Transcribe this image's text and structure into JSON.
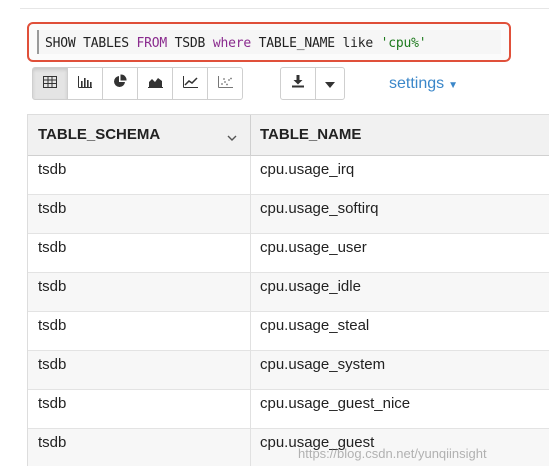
{
  "query": {
    "parts": [
      {
        "text": "SHOW TABLES ",
        "kind": "plain"
      },
      {
        "text": "FROM",
        "kind": "kw2"
      },
      {
        "text": " TSDB ",
        "kind": "plain"
      },
      {
        "text": "where",
        "kind": "kw2"
      },
      {
        "text": " TABLE_NAME like ",
        "kind": "plain"
      },
      {
        "text": "'cpu%'",
        "kind": "str"
      }
    ]
  },
  "toolbar": {
    "view_buttons": [
      {
        "name": "table-view-button",
        "icon": "table-icon",
        "active": true
      },
      {
        "name": "bar-chart-button",
        "icon": "bar-chart-icon",
        "active": false
      },
      {
        "name": "pie-chart-button",
        "icon": "pie-chart-icon",
        "active": false
      },
      {
        "name": "area-chart-button",
        "icon": "area-chart-icon",
        "active": false
      },
      {
        "name": "line-chart-button",
        "icon": "line-chart-icon",
        "active": false
      },
      {
        "name": "scatter-chart-button",
        "icon": "scatter-chart-icon",
        "active": false
      }
    ],
    "download_icon": "download-icon",
    "dropdown_icon": "caret-down-icon",
    "settings_label": "settings"
  },
  "table": {
    "columns": [
      "TABLE_SCHEMA",
      "TABLE_NAME"
    ],
    "sort_icon": "chevron-down-icon",
    "rows": [
      [
        "tsdb",
        "cpu.usage_irq"
      ],
      [
        "tsdb",
        "cpu.usage_softirq"
      ],
      [
        "tsdb",
        "cpu.usage_user"
      ],
      [
        "tsdb",
        "cpu.usage_idle"
      ],
      [
        "tsdb",
        "cpu.usage_steal"
      ],
      [
        "tsdb",
        "cpu.usage_system"
      ],
      [
        "tsdb",
        "cpu.usage_guest_nice"
      ],
      [
        "tsdb",
        "cpu.usage_guest"
      ]
    ]
  },
  "watermark": "https://blog.csdn.net/yunqiinsight",
  "colors": {
    "highlight_border": "#e0503a",
    "link": "#3b87c9",
    "keyword": "#8a2b8e",
    "string": "#1d7a1d"
  }
}
